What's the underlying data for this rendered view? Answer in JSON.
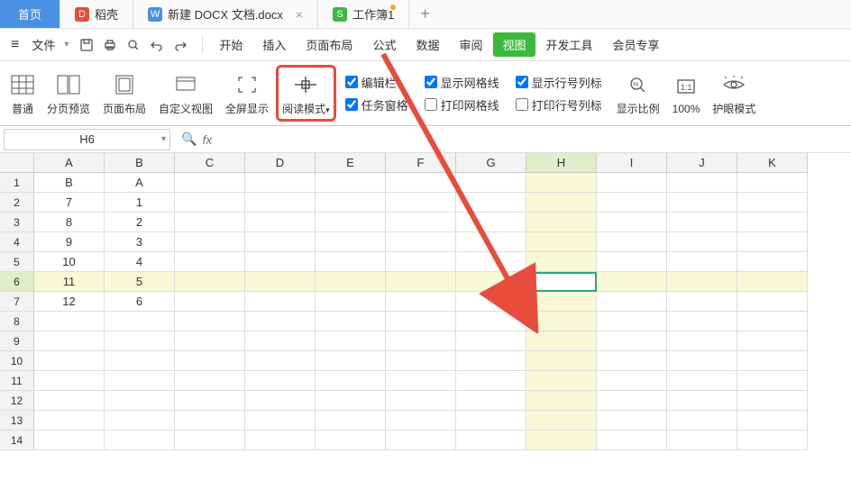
{
  "tabs": {
    "home": "首页",
    "docer": "稻壳",
    "docx": "新建 DOCX 文档.docx",
    "sheet": "工作簿1"
  },
  "menubar": {
    "file": "文件",
    "menus": [
      "开始",
      "插入",
      "页面布局",
      "公式",
      "数据",
      "审阅",
      "视图",
      "开发工具",
      "会员专享"
    ]
  },
  "ribbon": {
    "normal": "普通",
    "page_preview": "分页预览",
    "page_layout": "页面布局",
    "custom_view": "自定义视图",
    "fullscreen": "全屏显示",
    "reading_mode": "阅读模式",
    "edit_bar": "编辑栏",
    "task_pane": "任务窗格",
    "show_grid": "显示网格线",
    "print_grid": "打印网格线",
    "show_headers": "显示行号列标",
    "print_headers": "打印行号列标",
    "zoom_ratio": "显示比例",
    "zoom_100": "100%",
    "eye_protect": "护眼模式"
  },
  "namebox": "H6",
  "columns": [
    "A",
    "B",
    "C",
    "D",
    "E",
    "F",
    "G",
    "H",
    "I",
    "J",
    "K"
  ],
  "active_col": "H",
  "active_row": 6,
  "rows": [
    {
      "n": 1,
      "cells": [
        "B",
        "A",
        "",
        "",
        "",
        "",
        "",
        "",
        "",
        "",
        ""
      ]
    },
    {
      "n": 2,
      "cells": [
        "7",
        "1",
        "",
        "",
        "",
        "",
        "",
        "",
        "",
        "",
        ""
      ]
    },
    {
      "n": 3,
      "cells": [
        "8",
        "2",
        "",
        "",
        "",
        "",
        "",
        "",
        "",
        "",
        ""
      ]
    },
    {
      "n": 4,
      "cells": [
        "9",
        "3",
        "",
        "",
        "",
        "",
        "",
        "",
        "",
        "",
        ""
      ]
    },
    {
      "n": 5,
      "cells": [
        "10",
        "4",
        "",
        "",
        "",
        "",
        "",
        "",
        "",
        "",
        ""
      ]
    },
    {
      "n": 6,
      "cells": [
        "11",
        "5",
        "",
        "",
        "",
        "",
        "",
        "",
        "",
        "",
        ""
      ]
    },
    {
      "n": 7,
      "cells": [
        "12",
        "6",
        "",
        "",
        "",
        "",
        "",
        "",
        "",
        "",
        ""
      ]
    },
    {
      "n": 8,
      "cells": [
        "",
        "",
        "",
        "",
        "",
        "",
        "",
        "",
        "",
        "",
        ""
      ]
    },
    {
      "n": 9,
      "cells": [
        "",
        "",
        "",
        "",
        "",
        "",
        "",
        "",
        "",
        "",
        ""
      ]
    },
    {
      "n": 10,
      "cells": [
        "",
        "",
        "",
        "",
        "",
        "",
        "",
        "",
        "",
        "",
        ""
      ]
    },
    {
      "n": 11,
      "cells": [
        "",
        "",
        "",
        "",
        "",
        "",
        "",
        "",
        "",
        "",
        ""
      ]
    },
    {
      "n": 12,
      "cells": [
        "",
        "",
        "",
        "",
        "",
        "",
        "",
        "",
        "",
        "",
        ""
      ]
    },
    {
      "n": 13,
      "cells": [
        "",
        "",
        "",
        "",
        "",
        "",
        "",
        "",
        "",
        "",
        ""
      ]
    },
    {
      "n": 14,
      "cells": [
        "",
        "",
        "",
        "",
        "",
        "",
        "",
        "",
        "",
        "",
        ""
      ]
    }
  ],
  "checks": {
    "edit_bar": true,
    "task_pane": true,
    "show_grid": true,
    "print_grid": false,
    "show_headers": true,
    "print_headers": false
  }
}
